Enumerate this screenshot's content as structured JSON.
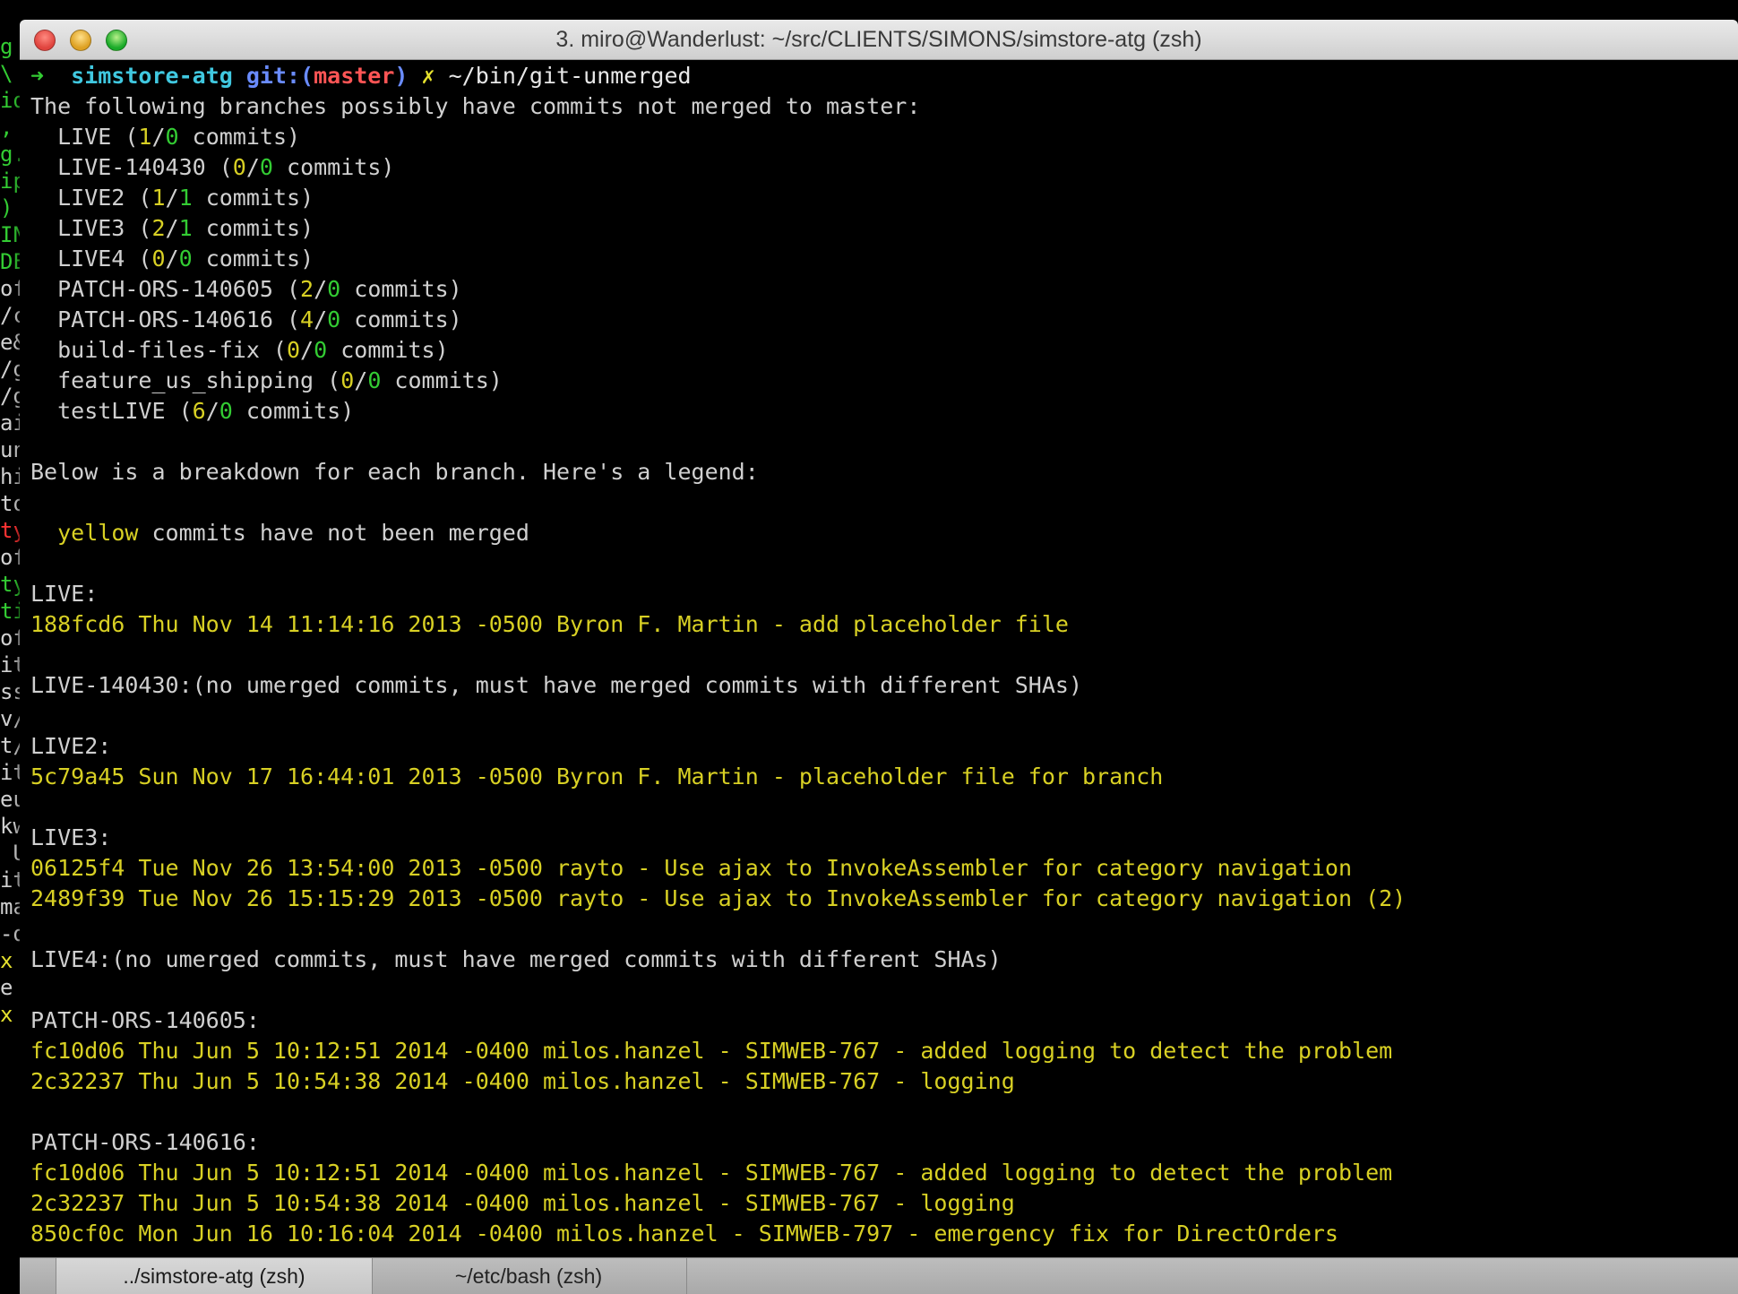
{
  "window": {
    "title": "3. miro@Wanderlust: ~/src/CLIENTS/SIMONS/simstore-atg (zsh)"
  },
  "background_terminal": {
    "fragments": [
      {
        "text": "g",
        "color": "#33cc33"
      },
      {
        "text": "\\",
        "color": "#33cc33"
      },
      {
        "text": "id",
        "color": "#33cc33"
      },
      {
        "text": ",",
        "color": "#33cc33"
      },
      {
        "text": "g.",
        "color": "#33cc33"
      },
      {
        "text": "ip",
        "color": "#33cc33"
      },
      {
        "text": ")",
        "color": "#33cc33"
      },
      {
        "text": "IN",
        "color": "#33cc33"
      },
      {
        "text": "DE",
        "color": "#33cc33"
      },
      {
        "text": "of",
        "color": "#d0d0d0"
      },
      {
        "text": "/c",
        "color": "#d0d0d0"
      },
      {
        "text": "e&",
        "color": "#d0d0d0"
      },
      {
        "text": "/g",
        "color": "#d0d0d0"
      },
      {
        "text": "/g",
        "color": "#d0d0d0"
      },
      {
        "text": "ai",
        "color": "#d0d0d0"
      },
      {
        "text": "un",
        "color": "#d0d0d0"
      },
      {
        "text": "hi",
        "color": "#d0d0d0"
      },
      {
        "text": "to",
        "color": "#d0d0d0"
      },
      {
        "text": "ty",
        "color": "#ff3333"
      },
      {
        "text": "of",
        "color": "#d0d0d0"
      },
      {
        "text": "ty",
        "color": "#33cc33"
      },
      {
        "text": "ti",
        "color": "#33cc33"
      },
      {
        "text": "of",
        "color": "#d0d0d0"
      },
      {
        "text": "it",
        "color": "#d0d0d0"
      },
      {
        "text": "ss",
        "color": "#d0d0d0"
      },
      {
        "text": "v/",
        "color": "#d0d0d0"
      },
      {
        "text": "t/",
        "color": "#d0d0d0"
      },
      {
        "text": "it",
        "color": "#d0d0d0"
      },
      {
        "text": "eu",
        "color": "#d0d0d0"
      },
      {
        "text": "kw",
        "color": "#d0d0d0"
      },
      {
        "text": " U",
        "color": "#d0d0d0"
      },
      {
        "text": "it",
        "color": "#d0d0d0"
      },
      {
        "text": "ma",
        "color": "#d0d0d0"
      },
      {
        "text": "-d",
        "color": "#d0d0d0"
      },
      {
        "text": "x",
        "color": "#e6e22e"
      },
      {
        "text": "e",
        "color": "#d0d0d0"
      },
      {
        "text": "x",
        "color": "#e6e22e"
      }
    ]
  },
  "terminal": {
    "lines": [
      [
        {
          "t": "➜  ",
          "c": "c-green"
        },
        {
          "t": "simstore-atg ",
          "c": "c-cyan"
        },
        {
          "t": "git:(",
          "c": "c-blue"
        },
        {
          "t": "master",
          "c": "c-red"
        },
        {
          "t": ") ",
          "c": "c-blue"
        },
        {
          "t": "✗ ",
          "c": "c-yellow"
        },
        {
          "t": "~/bin/git-unmerged",
          "c": "c-white"
        }
      ],
      [
        {
          "t": "The following branches possibly have commits not merged to master:",
          "c": "c-dim"
        }
      ],
      [
        {
          "t": "  LIVE (",
          "c": "c-dim"
        },
        {
          "t": "1",
          "c": "c-ylw"
        },
        {
          "t": "/",
          "c": "c-dim"
        },
        {
          "t": "0",
          "c": "c-green"
        },
        {
          "t": " commits)",
          "c": "c-dim"
        }
      ],
      [
        {
          "t": "  LIVE-140430 (",
          "c": "c-dim"
        },
        {
          "t": "0",
          "c": "c-ylw"
        },
        {
          "t": "/",
          "c": "c-dim"
        },
        {
          "t": "0",
          "c": "c-green"
        },
        {
          "t": " commits)",
          "c": "c-dim"
        }
      ],
      [
        {
          "t": "  LIVE2 (",
          "c": "c-dim"
        },
        {
          "t": "1",
          "c": "c-ylw"
        },
        {
          "t": "/",
          "c": "c-dim"
        },
        {
          "t": "1",
          "c": "c-green"
        },
        {
          "t": " commits)",
          "c": "c-dim"
        }
      ],
      [
        {
          "t": "  LIVE3 (",
          "c": "c-dim"
        },
        {
          "t": "2",
          "c": "c-ylw"
        },
        {
          "t": "/",
          "c": "c-dim"
        },
        {
          "t": "1",
          "c": "c-green"
        },
        {
          "t": " commits)",
          "c": "c-dim"
        }
      ],
      [
        {
          "t": "  LIVE4 (",
          "c": "c-dim"
        },
        {
          "t": "0",
          "c": "c-ylw"
        },
        {
          "t": "/",
          "c": "c-dim"
        },
        {
          "t": "0",
          "c": "c-green"
        },
        {
          "t": " commits)",
          "c": "c-dim"
        }
      ],
      [
        {
          "t": "  PATCH-ORS-140605 (",
          "c": "c-dim"
        },
        {
          "t": "2",
          "c": "c-ylw"
        },
        {
          "t": "/",
          "c": "c-dim"
        },
        {
          "t": "0",
          "c": "c-green"
        },
        {
          "t": " commits)",
          "c": "c-dim"
        }
      ],
      [
        {
          "t": "  PATCH-ORS-140616 (",
          "c": "c-dim"
        },
        {
          "t": "4",
          "c": "c-ylw"
        },
        {
          "t": "/",
          "c": "c-dim"
        },
        {
          "t": "0",
          "c": "c-green"
        },
        {
          "t": " commits)",
          "c": "c-dim"
        }
      ],
      [
        {
          "t": "  build-files-fix (",
          "c": "c-dim"
        },
        {
          "t": "0",
          "c": "c-ylw"
        },
        {
          "t": "/",
          "c": "c-dim"
        },
        {
          "t": "0",
          "c": "c-green"
        },
        {
          "t": " commits)",
          "c": "c-dim"
        }
      ],
      [
        {
          "t": "  feature_us_shipping (",
          "c": "c-dim"
        },
        {
          "t": "0",
          "c": "c-ylw"
        },
        {
          "t": "/",
          "c": "c-dim"
        },
        {
          "t": "0",
          "c": "c-green"
        },
        {
          "t": " commits)",
          "c": "c-dim"
        }
      ],
      [
        {
          "t": "  testLIVE (",
          "c": "c-dim"
        },
        {
          "t": "6",
          "c": "c-ylw"
        },
        {
          "t": "/",
          "c": "c-dim"
        },
        {
          "t": "0",
          "c": "c-green"
        },
        {
          "t": " commits)",
          "c": "c-dim"
        }
      ],
      [
        {
          "t": "",
          "c": "c-dim"
        }
      ],
      [
        {
          "t": "Below is a breakdown for each branch. Here's a legend:",
          "c": "c-dim"
        }
      ],
      [
        {
          "t": "",
          "c": "c-dim"
        }
      ],
      [
        {
          "t": "  ",
          "c": "c-dim"
        },
        {
          "t": "yellow",
          "c": "c-ylw"
        },
        {
          "t": " commits have not been merged",
          "c": "c-dim"
        }
      ],
      [
        {
          "t": "",
          "c": "c-dim"
        }
      ],
      [
        {
          "t": "LIVE:",
          "c": "c-dim"
        }
      ],
      [
        {
          "t": "188fcd6 Thu Nov 14 11:14:16 2013 -0500 Byron F. Martin - add placeholder file",
          "c": "c-ylw"
        }
      ],
      [
        {
          "t": "",
          "c": "c-dim"
        }
      ],
      [
        {
          "t": "LIVE-140430:(no umerged commits, must have merged commits with different SHAs)",
          "c": "c-dim"
        }
      ],
      [
        {
          "t": "",
          "c": "c-dim"
        }
      ],
      [
        {
          "t": "LIVE2:",
          "c": "c-dim"
        }
      ],
      [
        {
          "t": "5c79a45 Sun Nov 17 16:44:01 2013 -0500 Byron F. Martin - placeholder file for branch",
          "c": "c-ylw"
        }
      ],
      [
        {
          "t": "",
          "c": "c-dim"
        }
      ],
      [
        {
          "t": "LIVE3:",
          "c": "c-dim"
        }
      ],
      [
        {
          "t": "06125f4 Tue Nov 26 13:54:00 2013 -0500 rayto - Use ajax to InvokeAssembler for category navigation",
          "c": "c-ylw"
        }
      ],
      [
        {
          "t": "2489f39 Tue Nov 26 15:15:29 2013 -0500 rayto - Use ajax to InvokeAssembler for category navigation (2)",
          "c": "c-ylw"
        }
      ],
      [
        {
          "t": "",
          "c": "c-dim"
        }
      ],
      [
        {
          "t": "LIVE4:(no umerged commits, must have merged commits with different SHAs)",
          "c": "c-dim"
        }
      ],
      [
        {
          "t": "",
          "c": "c-dim"
        }
      ],
      [
        {
          "t": "PATCH-ORS-140605:",
          "c": "c-dim"
        }
      ],
      [
        {
          "t": "fc10d06 Thu Jun 5 10:12:51 2014 -0400 milos.hanzel - SIMWEB-767 - added logging to detect the problem",
          "c": "c-ylw"
        }
      ],
      [
        {
          "t": "2c32237 Thu Jun 5 10:54:38 2014 -0400 milos.hanzel - SIMWEB-767 - logging",
          "c": "c-ylw"
        }
      ],
      [
        {
          "t": "",
          "c": "c-dim"
        }
      ],
      [
        {
          "t": "PATCH-ORS-140616:",
          "c": "c-dim"
        }
      ],
      [
        {
          "t": "fc10d06 Thu Jun 5 10:12:51 2014 -0400 milos.hanzel - SIMWEB-767 - added logging to detect the problem",
          "c": "c-ylw"
        }
      ],
      [
        {
          "t": "2c32237 Thu Jun 5 10:54:38 2014 -0400 milos.hanzel - SIMWEB-767 - logging",
          "c": "c-ylw"
        }
      ],
      [
        {
          "t": "850cf0c Mon Jun 16 10:16:04 2014 -0400 milos.hanzel - SIMWEB-797 - emergency fix for DirectOrders",
          "c": "c-ylw"
        }
      ]
    ]
  },
  "tabs": [
    {
      "label": "../simstore-atg (zsh)",
      "active": true
    },
    {
      "label": "~/etc/bash (zsh)",
      "active": false
    }
  ]
}
